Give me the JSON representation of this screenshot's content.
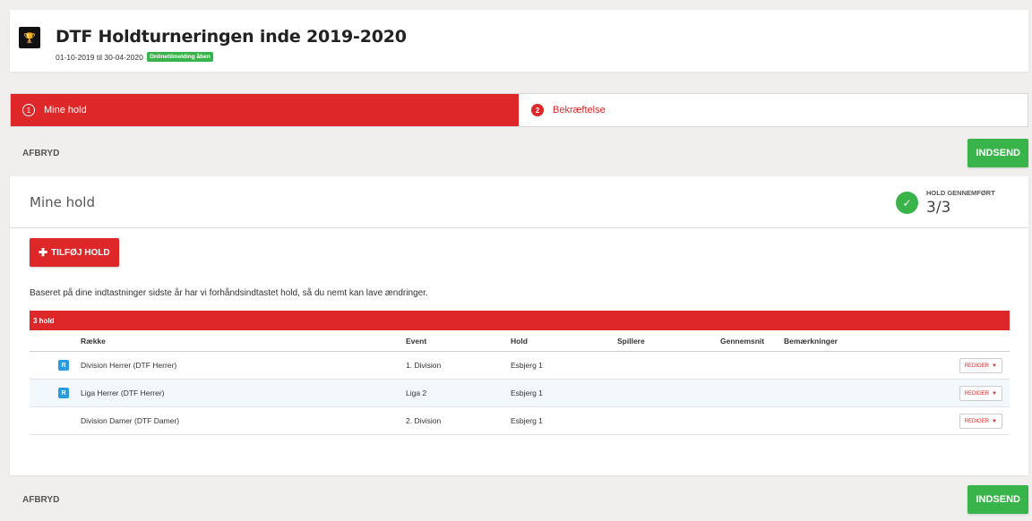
{
  "header": {
    "icon": "trophy-icon",
    "title": "DTF Holdturneringen inde 2019-2020",
    "dates": "01-10-2019 til 30-04-2020",
    "badge": "Onlinetilmelding åben"
  },
  "steps": [
    {
      "num": "1",
      "label": "Mine hold"
    },
    {
      "num": "2",
      "label": "Bekræftelse"
    }
  ],
  "actions": {
    "cancel": "AFBRYD",
    "submit": "INDSEND"
  },
  "card": {
    "title": "Mine hold",
    "progress_label": "HOLD GENNEMFØRT",
    "progress_value": "3/3",
    "add_button": "TILFØJ HOLD",
    "info": "Baseret på dine indtastninger sidste år har vi forhåndsindtastet hold, så du nemt kan lave ændringer."
  },
  "table": {
    "banner": "3 hold",
    "columns": [
      "Række",
      "Event",
      "Hold",
      "Spillere",
      "Gennemsnit",
      "Bemærkninger"
    ],
    "edit_label": "REDIGER",
    "rows": [
      {
        "badge": "R",
        "rank": "Division Herrer (DTF Herrer)",
        "event": "1. Division",
        "team": "Esbjerg 1"
      },
      {
        "badge": "R",
        "rank": "Liga Herrer (DTF Herrer)",
        "event": "Liga 2",
        "team": "Esbjerg 1"
      },
      {
        "badge": "",
        "rank": "Division Damer (DTF Damer)",
        "event": "2. Division",
        "team": "Esbjerg 1"
      }
    ]
  },
  "colors": {
    "accent": "#dd2729",
    "success": "#38b44a",
    "badge_blue": "#2a9be0"
  }
}
